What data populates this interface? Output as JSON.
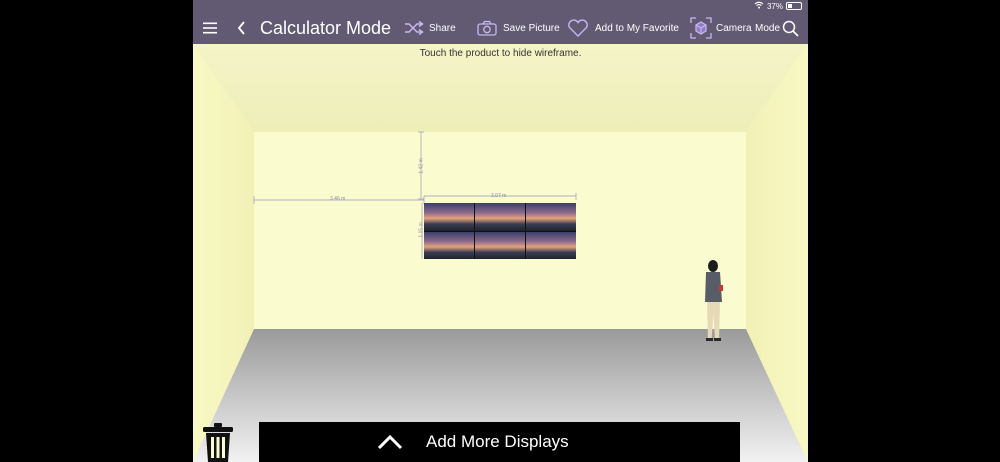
{
  "status_bar": {
    "battery": "37%",
    "battery_level": 0.37
  },
  "toolbar": {
    "title": "Calculator Mode",
    "share_label": "Share",
    "save_picture_label": "Save Picture",
    "favorite_label": "Add to My Favorite",
    "camera_label": "Camera",
    "mode_label": "Mode"
  },
  "room": {
    "hint": "Touch the product to hide wireframe.",
    "dimensions": {
      "height_above": "1.42 m",
      "left_offset": "3.46 m",
      "display_width": "3.07 m",
      "display_height": "1.15 m"
    }
  },
  "bottom": {
    "add_displays_label": "Add More Displays"
  },
  "colors": {
    "toolbar_bg": "#625a72",
    "wall": "#fbfbd0",
    "icon_accent": "#c9b6f2"
  }
}
